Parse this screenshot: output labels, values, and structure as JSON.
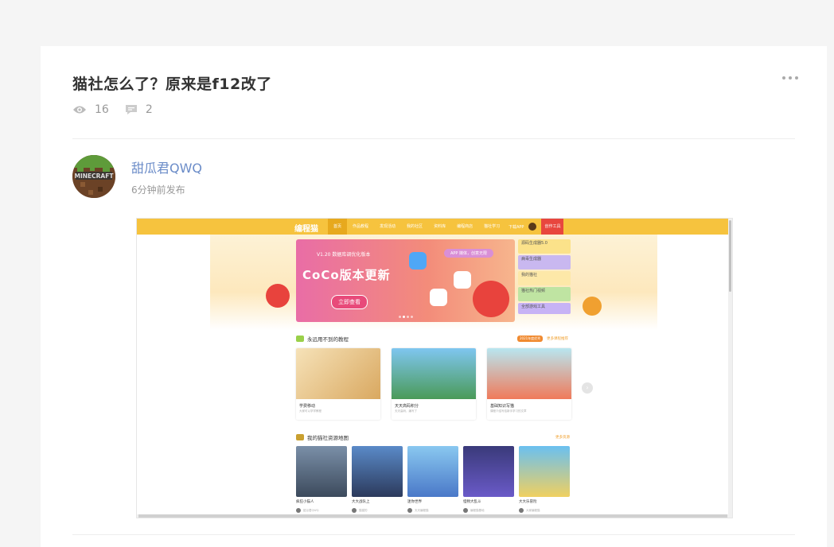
{
  "post": {
    "title": "猫社怎么了？原来是f12改了",
    "views": "16",
    "comments": "2"
  },
  "author": {
    "name": "甜瓜君QWQ",
    "time": "6分钟前发布"
  },
  "screenshot": {
    "logo": "编程猫",
    "nav": [
      "首页",
      "作品教程",
      "发现活动",
      "我的社区",
      "资料库",
      "编程商店",
      "猫社学习"
    ],
    "download": "下载APP",
    "create": "创作工具",
    "hero": {
      "version": "V1.20 数据库调优化版本",
      "headline": "CoCo版本更新",
      "button": "立即查看",
      "pill": "APP 媒体，创意无限"
    },
    "side": [
      "源码生成器5.0",
      "病毒生成器",
      "我的猫社",
      "猫社热门视频",
      "全部游戏工具"
    ],
    "section1": {
      "title": "永远用不到的教程",
      "more": "更多课程推荐",
      "tag": "2021年度优秀"
    },
    "courses": [
      {
        "title": "学费移动",
        "desc": "大家可以学学教程"
      },
      {
        "title": "天天高码积分",
        "desc": "天天高码，编写了"
      },
      {
        "title": "基础知识写猫",
        "desc": "课程介绍写给新手学习的文章"
      }
    ],
    "section2": {
      "title": "我的猫社资源地图",
      "more": "更多资源"
    },
    "games": [
      {
        "title": "疯狂小猫人",
        "user": "甜瓜君QWQ"
      },
      {
        "title": "大大战队上",
        "user": "猫猫的"
      },
      {
        "title": "迷你世界",
        "user": "天天编程猫"
      },
      {
        "title": "怪物大乱斗",
        "user": "编程猫基地"
      },
      {
        "title": "大大乐冒险",
        "user": "大家编程猫"
      }
    ]
  },
  "colors": {
    "accent": "#6b8cc8",
    "navYellow": "#f6c33e"
  }
}
